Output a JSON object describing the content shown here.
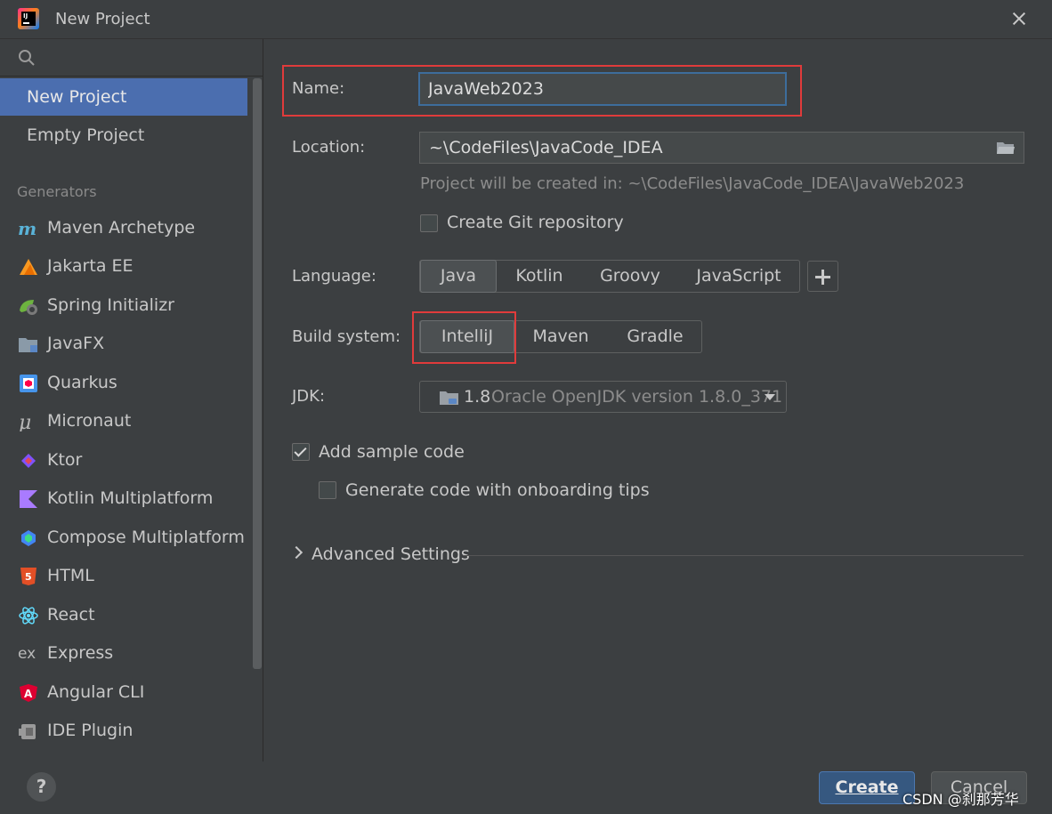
{
  "window": {
    "title": "New Project"
  },
  "sidebar": {
    "search_placeholder": "",
    "top_items": [
      {
        "label": "New Project"
      },
      {
        "label": "Empty Project"
      }
    ],
    "section_label": "Generators",
    "generators": [
      {
        "label": "Maven Archetype",
        "icon": "maven-icon"
      },
      {
        "label": "Jakarta EE",
        "icon": "jakarta-ee-icon"
      },
      {
        "label": "Spring Initializr",
        "icon": "spring-icon"
      },
      {
        "label": "JavaFX",
        "icon": "javafx-icon"
      },
      {
        "label": "Quarkus",
        "icon": "quarkus-icon"
      },
      {
        "label": "Micronaut",
        "icon": "micronaut-icon"
      },
      {
        "label": "Ktor",
        "icon": "ktor-icon"
      },
      {
        "label": "Kotlin Multiplatform",
        "icon": "kotlin-icon"
      },
      {
        "label": "Compose Multiplatform",
        "icon": "compose-icon"
      },
      {
        "label": "HTML",
        "icon": "html5-icon"
      },
      {
        "label": "React",
        "icon": "react-icon"
      },
      {
        "label": "Express",
        "icon": "express-icon"
      },
      {
        "label": "Angular CLI",
        "icon": "angular-icon"
      },
      {
        "label": "IDE Plugin",
        "icon": "plugin-icon"
      }
    ]
  },
  "form": {
    "name_label": "Name:",
    "name_value": "JavaWeb2023",
    "location_label": "Location:",
    "location_value": "~\\CodeFiles\\JavaCode_IDEA",
    "location_hint": "Project will be created in: ~\\CodeFiles\\JavaCode_IDEA\\JavaWeb2023",
    "git_label": "Create Git repository",
    "language_label": "Language:",
    "languages": [
      "Java",
      "Kotlin",
      "Groovy",
      "JavaScript"
    ],
    "build_label": "Build system:",
    "build_systems": [
      "IntelliJ",
      "Maven",
      "Gradle"
    ],
    "jdk_label": "JDK:",
    "jdk_version": "1.8",
    "jdk_name": "Oracle OpenJDK version 1.8.0_371",
    "sample_code_label": "Add sample code",
    "onboarding_label": "Generate code with onboarding tips",
    "advanced_label": "Advanced Settings"
  },
  "footer": {
    "help_label": "?",
    "create_label": "Create",
    "cancel_label": "Cancel"
  },
  "watermark": "CSDN @刹那芳华"
}
